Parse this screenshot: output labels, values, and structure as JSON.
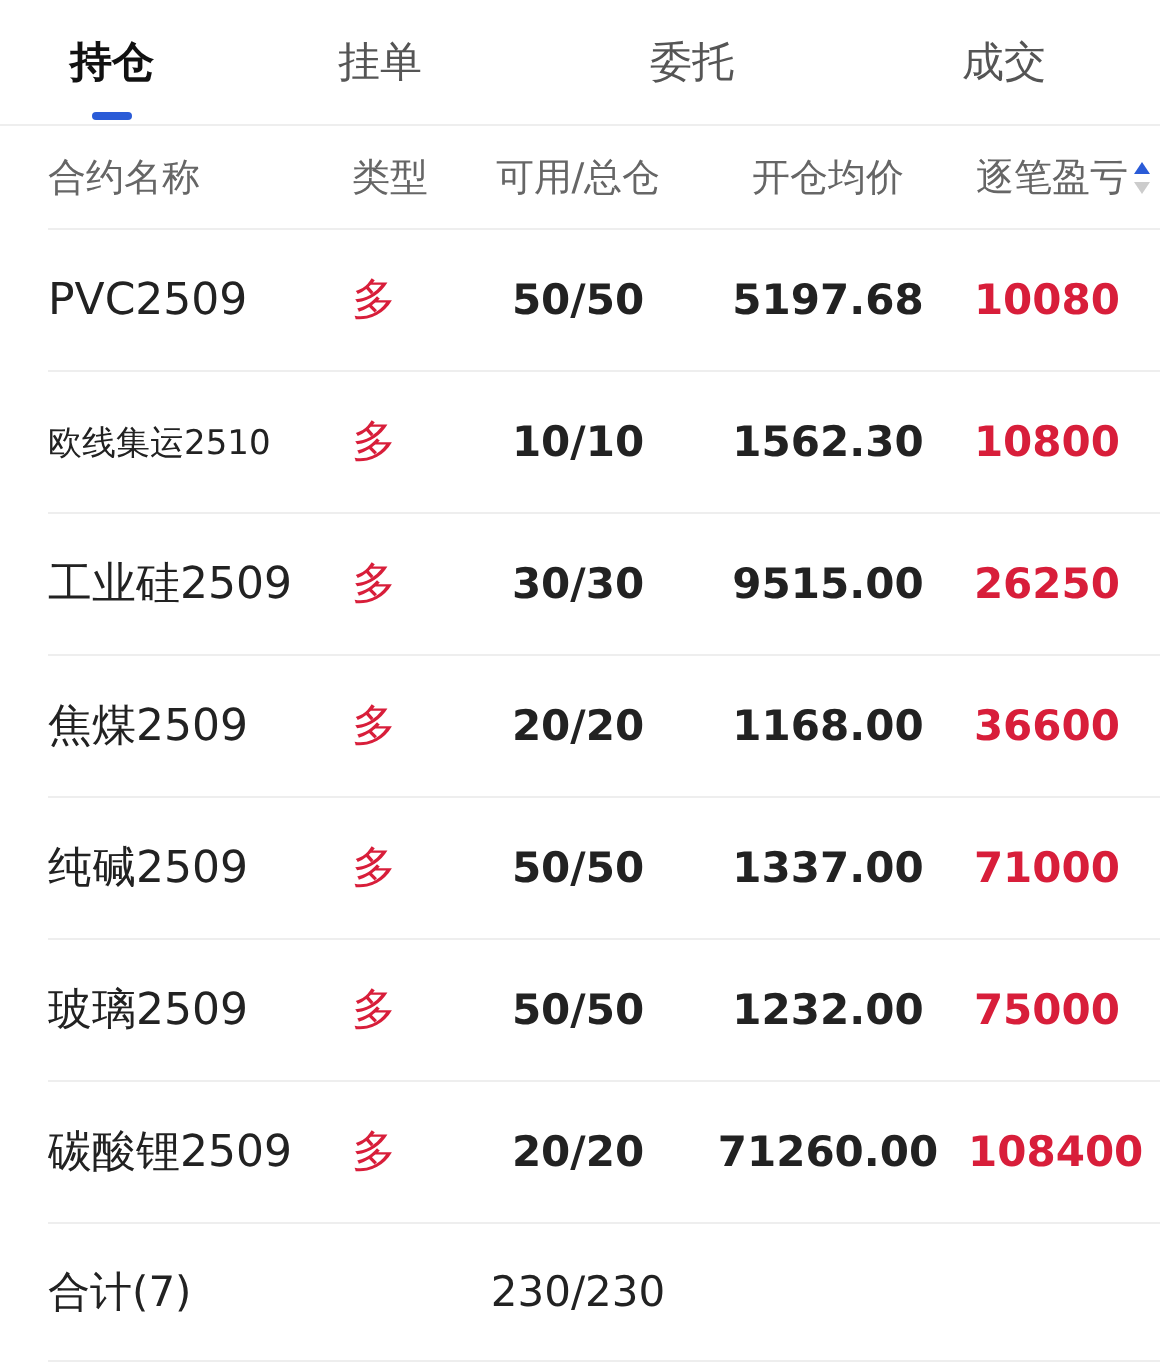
{
  "tabs": [
    {
      "label": "持仓",
      "selected": true
    },
    {
      "label": "挂单",
      "selected": false
    },
    {
      "label": "委托",
      "selected": false
    },
    {
      "label": "成交",
      "selected": false
    }
  ],
  "table": {
    "columns": [
      {
        "label": "合约名称"
      },
      {
        "label": "类型"
      },
      {
        "label": "可用/总仓"
      },
      {
        "label": "开仓均价"
      },
      {
        "label": "逐笔盈亏",
        "sort_ascending": true
      }
    ],
    "rows": [
      {
        "contract": "PVC2509",
        "side": "多",
        "long": true,
        "volume": "50/50",
        "avg_price": "5197.68",
        "pnl": "10080"
      },
      {
        "contract": "欧线集运2510",
        "side": "多",
        "long": true,
        "volume": "10/10",
        "avg_price": "1562.30",
        "pnl": "10800"
      },
      {
        "contract": "工业硅2509",
        "side": "多",
        "long": true,
        "volume": "30/30",
        "avg_price": "9515.00",
        "pnl": "26250"
      },
      {
        "contract": "焦煤2509",
        "side": "多",
        "long": true,
        "volume": "20/20",
        "avg_price": "1168.00",
        "pnl": "36600"
      },
      {
        "contract": "纯碱2509",
        "side": "多",
        "long": true,
        "volume": "50/50",
        "avg_price": "1337.00",
        "pnl": "71000"
      },
      {
        "contract": "玻璃2509",
        "side": "多",
        "long": true,
        "volume": "50/50",
        "avg_price": "1232.00",
        "pnl": "75000"
      },
      {
        "contract": "碳酸锂2509",
        "side": "多",
        "long": true,
        "volume": "20/20",
        "avg_price": "71260.00",
        "pnl": "108400"
      }
    ],
    "total": {
      "label": "合计(7)",
      "volume": "230/230"
    }
  }
}
